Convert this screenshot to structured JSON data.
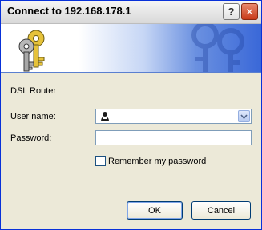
{
  "window": {
    "title": "Connect to 192.168.178.1"
  },
  "titlebar": {
    "help_glyph": "?",
    "close_glyph": "✕"
  },
  "banner": {
    "icon": "keys-icon",
    "watermark": "keys-watermark-icon"
  },
  "form": {
    "realm": "DSL Router",
    "username_label": "User name:",
    "username_value": "",
    "password_label": "Password:",
    "password_value": "",
    "remember_label": "Remember my password",
    "remember_checked": false
  },
  "buttons": {
    "ok": "OK",
    "cancel": "Cancel"
  },
  "colors": {
    "accent": "#3a68d8",
    "title_close": "#c83a18",
    "face": "#ece9d8"
  }
}
